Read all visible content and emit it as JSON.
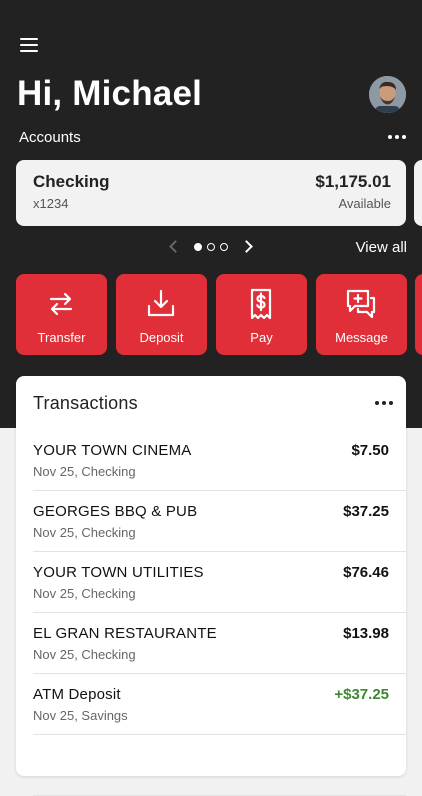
{
  "header": {
    "greeting": "Hi, Michael",
    "accounts_label": "Accounts",
    "view_all": "View all"
  },
  "account": {
    "name": "Checking",
    "number": "x1234",
    "balance": "$1,175.01",
    "balance_label": "Available"
  },
  "pager": {
    "current_page": 1,
    "total_pages": 3
  },
  "actions": [
    {
      "label": "Transfer",
      "icon": "transfer-icon"
    },
    {
      "label": "Deposit",
      "icon": "deposit-icon"
    },
    {
      "label": "Pay",
      "icon": "pay-bill-icon"
    },
    {
      "label": "Message",
      "icon": "message-icon"
    }
  ],
  "transactions": {
    "title": "Transactions",
    "items": [
      {
        "merchant": "YOUR TOWN CINEMA",
        "detail": "Nov 25, Checking",
        "amount": "$7.50"
      },
      {
        "merchant": "GEORGES BBQ & PUB",
        "detail": "Nov 25, Checking",
        "amount": "$37.25"
      },
      {
        "merchant": "YOUR TOWN UTILITIES",
        "detail": "Nov 25, Checking",
        "amount": "$76.46"
      },
      {
        "merchant": "EL GRAN RESTAURANTE",
        "detail": "Nov 25, Checking",
        "amount": "$13.98"
      },
      {
        "merchant": "ATM Deposit",
        "detail": "Nov 25, Savings",
        "amount": "+$37.25"
      }
    ]
  },
  "colors": {
    "header_bg": "#222222",
    "accent_red": "#e02f38",
    "positive_green": "#3a8a2d"
  }
}
